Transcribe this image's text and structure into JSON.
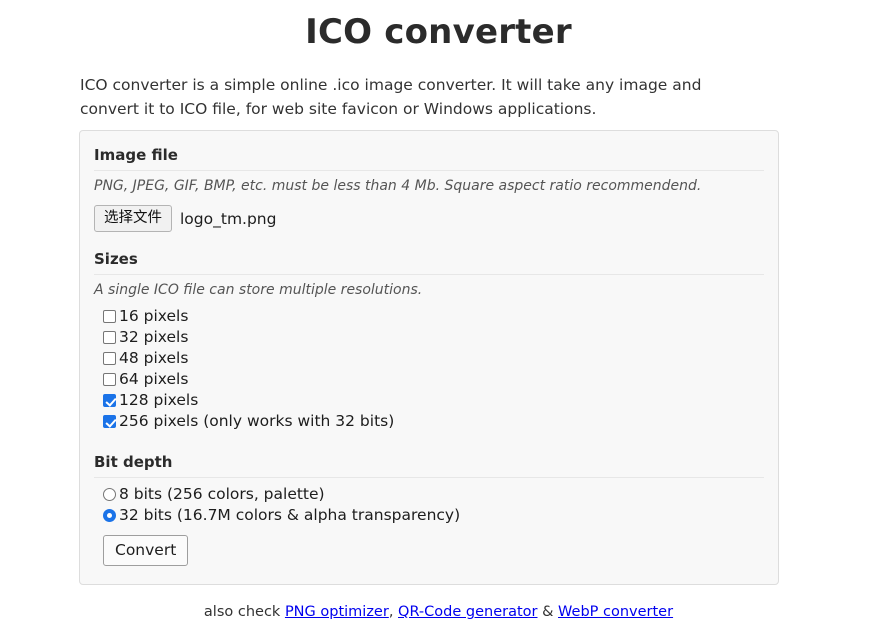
{
  "header": {
    "title": "ICO converter",
    "intro": "ICO converter is a simple online .ico image converter. It will take any image and convert it to ICO file, for web site favicon or Windows applications."
  },
  "form": {
    "image_file": {
      "heading": "Image file",
      "help": "PNG, JPEG, GIF, BMP, etc. must be less than 4 Mb. Square aspect ratio recommendend.",
      "browse_button_label": "选择文件",
      "file_name": "logo_tm.png"
    },
    "sizes": {
      "heading": "Sizes",
      "help": "A single ICO file can store multiple resolutions.",
      "options": [
        {
          "label": "16 pixels",
          "checked": false
        },
        {
          "label": "32 pixels",
          "checked": false
        },
        {
          "label": "48 pixels",
          "checked": false
        },
        {
          "label": "64 pixels",
          "checked": false
        },
        {
          "label": "128 pixels",
          "checked": true
        },
        {
          "label": "256 pixels (only works with 32 bits)",
          "checked": true
        }
      ]
    },
    "bit_depth": {
      "heading": "Bit depth",
      "options": [
        {
          "label": "8 bits (256 colors, palette)",
          "selected": false
        },
        {
          "label": "32 bits (16.7M colors & alpha transparency)",
          "selected": true
        }
      ]
    },
    "submit_label": "Convert"
  },
  "footer": {
    "prefix": "also check ",
    "link1": "PNG optimizer",
    "sep1": ", ",
    "link2": "QR-Code generator",
    "sep2": " & ",
    "link3": "WebP converter"
  },
  "colors": {
    "accent": "#1b73e8",
    "link": "#0000ee",
    "panel_bg": "#f8f8f8",
    "panel_border": "#dddddd"
  }
}
